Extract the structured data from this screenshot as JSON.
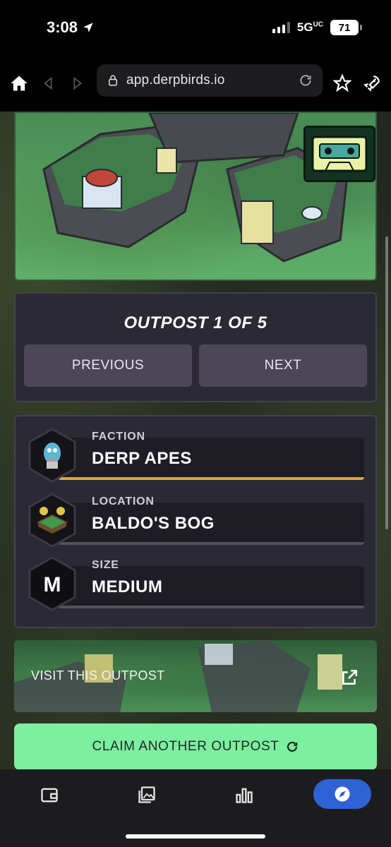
{
  "status_bar": {
    "time": "3:08",
    "network": "5G",
    "network_suffix": "UC",
    "battery": "71"
  },
  "browser": {
    "url": "app.derpbirds.io",
    "icons": [
      "home-icon",
      "back-icon",
      "forward-icon",
      "lock-icon",
      "reload-icon",
      "star-icon",
      "rocket-icon"
    ]
  },
  "outpost": {
    "title": "OUTPOST 1 OF 5",
    "previous_label": "PREVIOUS",
    "next_label": "NEXT"
  },
  "info": {
    "faction": {
      "label": "FACTION",
      "value": "DERP APES"
    },
    "location": {
      "label": "LOCATION",
      "value": "BALDO'S BOG"
    },
    "size": {
      "label": "SIZE",
      "value": "MEDIUM",
      "badge": "M"
    }
  },
  "visit": {
    "label": "VISIT THIS OUTPOST"
  },
  "claim": {
    "label": "CLAIM ANOTHER OUTPOST"
  },
  "bottom_nav": {
    "items": [
      "wallet-icon",
      "gallery-icon",
      "stats-icon",
      "compass-icon"
    ],
    "active": "compass-icon"
  },
  "colors": {
    "accent_green": "#7cf0a0",
    "active_tab": "#2f62d4",
    "faction_underline": "#e2a24a",
    "card_bg": "#2b2a34"
  }
}
